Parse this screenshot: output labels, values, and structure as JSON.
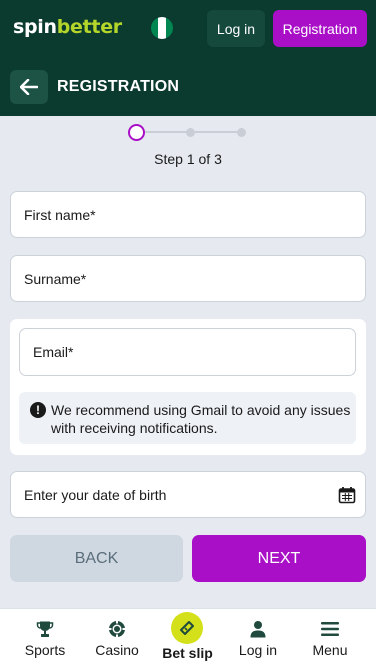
{
  "app": {
    "logo_part1": "spin",
    "logo_part2": "better",
    "flag_colors": [
      "#008751",
      "#ffffff",
      "#008751"
    ]
  },
  "topbar": {
    "login_label": "Log in",
    "registration_label": "Registration"
  },
  "header": {
    "title": "REGISTRATION"
  },
  "steps": {
    "current": 1,
    "total": 3,
    "text": "Step 1 of 3"
  },
  "form": {
    "first_name_placeholder": "First name*",
    "surname_placeholder": "Surname*",
    "email_placeholder": "Email*",
    "notice_text": "We recommend using Gmail to avoid any issues with receiving notifications.",
    "dob_placeholder": "Enter your date of birth",
    "back_label": "BACK",
    "next_label": "NEXT"
  },
  "bottom_nav": {
    "items": [
      {
        "label": "Sports",
        "icon": "trophy-icon"
      },
      {
        "label": "Casino",
        "icon": "casino-chip-icon"
      },
      {
        "label": "Bet slip",
        "icon": "bet-slip-icon"
      },
      {
        "label": "Log in",
        "icon": "user-icon"
      },
      {
        "label": "Menu",
        "icon": "menu-icon"
      }
    ]
  },
  "colors": {
    "brand_dark": "#0b3a2f",
    "accent_purple": "#a90fc7",
    "accent_lime": "#b4d62a"
  }
}
